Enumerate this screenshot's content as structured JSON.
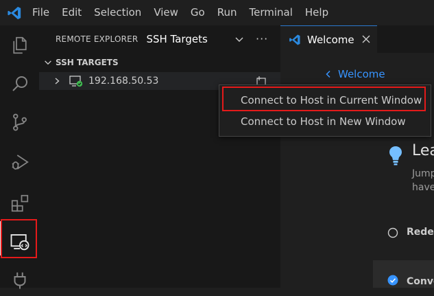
{
  "menu": [
    "File",
    "Edit",
    "Selection",
    "View",
    "Go",
    "Run",
    "Terminal",
    "Help"
  ],
  "activity_bar": {
    "icons": [
      "explorer-icon",
      "search-icon",
      "source-control-icon",
      "run-debug-icon",
      "extensions-icon",
      "remote-explorer-icon",
      "plug-icon"
    ],
    "active": "remote-explorer-icon"
  },
  "sidebar": {
    "title": "REMOTE EXPLORER",
    "selected_target": "SSH Targets",
    "more": "···",
    "section": "SSH TARGETS",
    "hosts": [
      {
        "label": "192.168.50.53",
        "status": "connected"
      }
    ]
  },
  "context_menu": {
    "items": [
      "Connect to Host in Current Window",
      "Connect to Host in New Window"
    ],
    "highlighted": 0
  },
  "tabs": [
    {
      "label": "Welcome",
      "active": true
    }
  ],
  "editor": {
    "back_link": "Welcome",
    "section_title": "Lea",
    "section_desc_1": "Jump",
    "section_desc_2": "have",
    "step1": "Redef",
    "step2": "Conve"
  },
  "colors": {
    "accent": "#3794ff",
    "highlight_border": "#e51a1a",
    "status_green": "#3fb950",
    "brand_blue": "#2b79d0"
  }
}
